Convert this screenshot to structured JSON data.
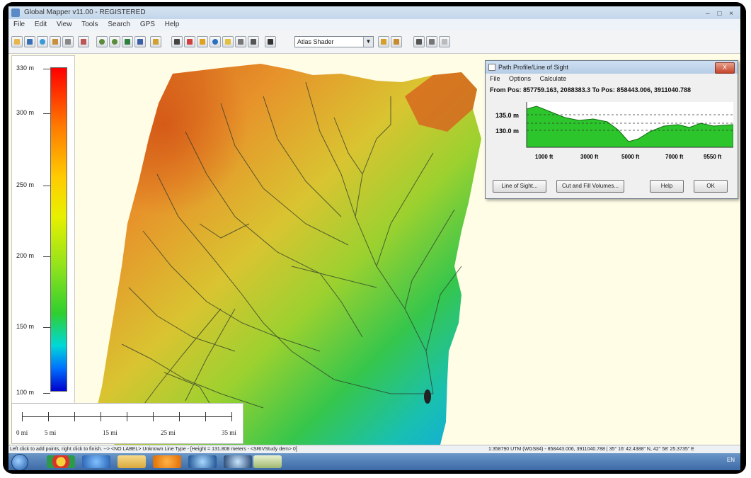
{
  "window": {
    "title": "Global Mapper v11.00 - REGISTERED",
    "controls": "– □ ×"
  },
  "menu": [
    "File",
    "Edit",
    "View",
    "Tools",
    "Search",
    "GPS",
    "Help"
  ],
  "toolbar": {
    "shader_select": "Atlas Shader"
  },
  "legend": {
    "labels": [
      "330 m",
      "300 m",
      "250 m",
      "200 m",
      "150 m",
      "100 m"
    ]
  },
  "scale": {
    "labels": [
      "0 mi",
      "5 mi",
      "15 mi",
      "25 mi",
      "35 mi"
    ]
  },
  "dialog": {
    "title": "Path Profile/Line of Sight",
    "close": "X",
    "menu": [
      "File",
      "Options",
      "Calculate"
    ],
    "position_text": "From Pos: 857759.163, 2088383.3 To Pos: 858443.006, 3911040.788",
    "y_labels": [
      "135.0 m",
      "130.0 m"
    ],
    "x_labels": [
      "1000 ft",
      "3000 ft",
      "5000 ft",
      "7000 ft",
      "9550 ft"
    ],
    "buttons": {
      "line_of_sight": "Line of Sight...",
      "cut_fill": "Cut and Fill Volumes...",
      "help": "Help",
      "ok": "OK"
    }
  },
  "status": {
    "left": "Left click to add points, right click to finish. --> <NO LABEL> Unknown Line Type - [Height = 131.808 meters - <SRIVStudy dem> 0]",
    "right": "1:358790   UTM (WGS84) - 858443.006, 3911040.788 | 35° 16' 42.4388\" N, 42° 58' 25.3735\" E"
  },
  "taskbar": {
    "tray_text": "EN"
  }
}
